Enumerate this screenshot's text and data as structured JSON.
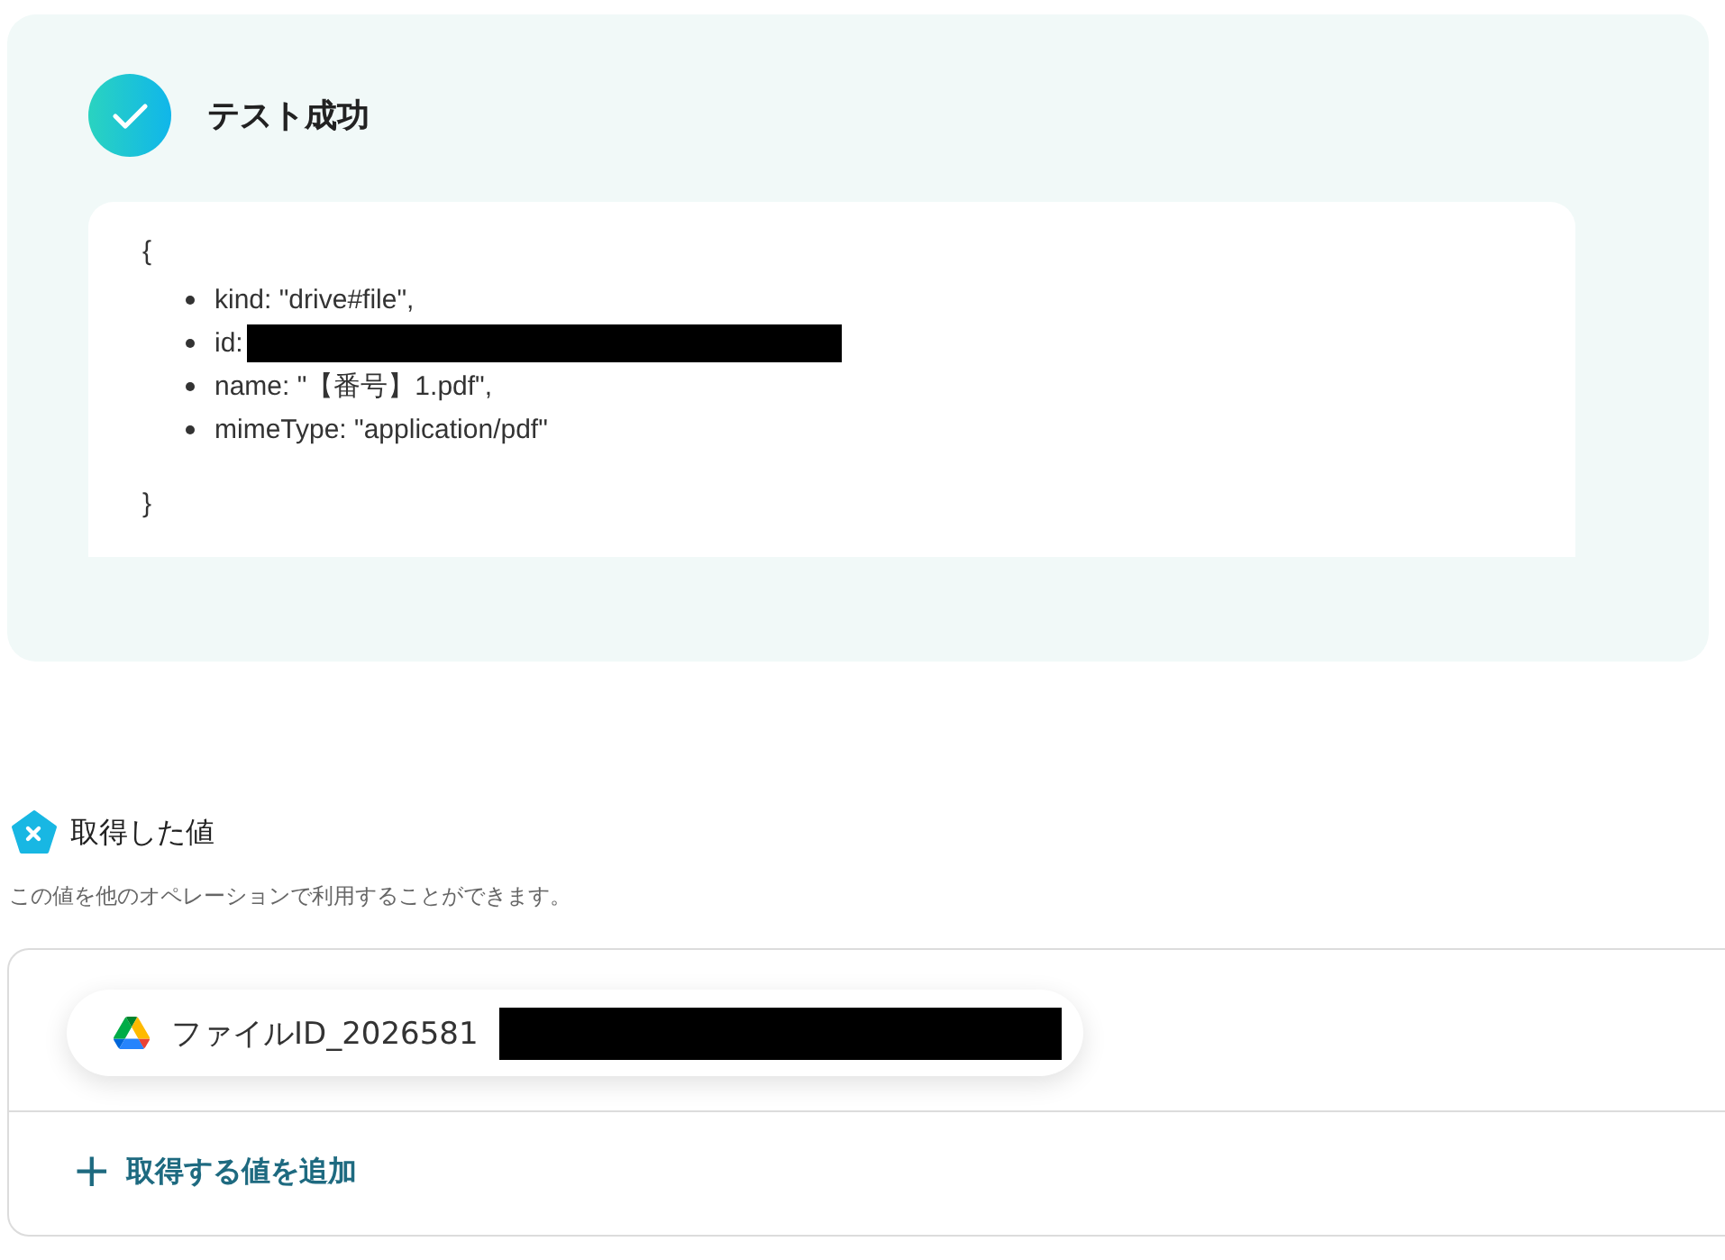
{
  "test_result": {
    "title": "テスト成功",
    "success": true,
    "open_brace": "{",
    "close_brace": "}",
    "fields": [
      {
        "text": "kind: \"drive#file\",",
        "redacted": false
      },
      {
        "text": "id:",
        "redacted": true
      },
      {
        "text": "name: \"【番号】1.pdf\",",
        "redacted": false
      },
      {
        "text": "mimeType: \"application/pdf\"",
        "redacted": false
      }
    ]
  },
  "obtained_values": {
    "title": "取得した値",
    "description": "この値を他のオペレーションで利用することができます。",
    "values": [
      {
        "label": "ファイルID_2026581",
        "redacted": true
      }
    ],
    "add_button": {
      "icon": "+",
      "label": "取得する値を追加"
    }
  }
}
